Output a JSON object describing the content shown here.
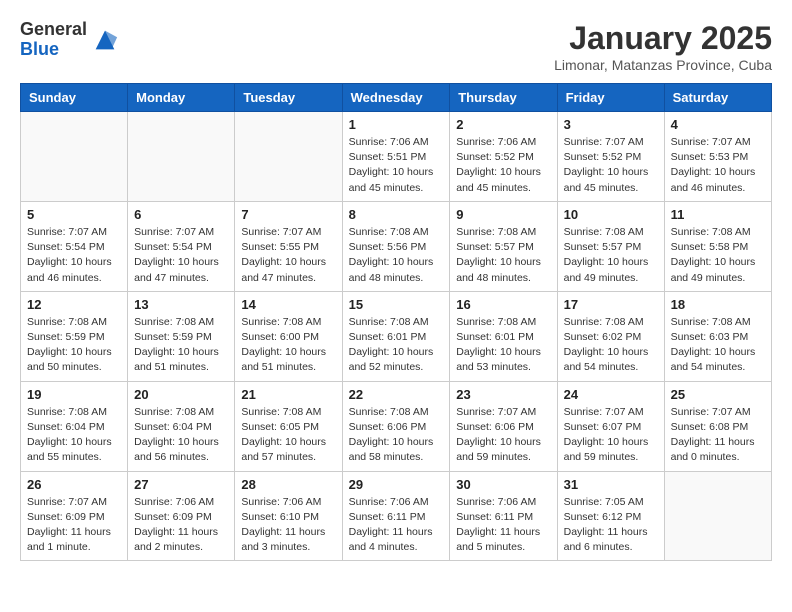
{
  "header": {
    "logo_general": "General",
    "logo_blue": "Blue",
    "month": "January 2025",
    "location": "Limonar, Matanzas Province, Cuba"
  },
  "days_of_week": [
    "Sunday",
    "Monday",
    "Tuesday",
    "Wednesday",
    "Thursday",
    "Friday",
    "Saturday"
  ],
  "weeks": [
    [
      {
        "day": "",
        "info": ""
      },
      {
        "day": "",
        "info": ""
      },
      {
        "day": "",
        "info": ""
      },
      {
        "day": "1",
        "info": "Sunrise: 7:06 AM\nSunset: 5:51 PM\nDaylight: 10 hours\nand 45 minutes."
      },
      {
        "day": "2",
        "info": "Sunrise: 7:06 AM\nSunset: 5:52 PM\nDaylight: 10 hours\nand 45 minutes."
      },
      {
        "day": "3",
        "info": "Sunrise: 7:07 AM\nSunset: 5:52 PM\nDaylight: 10 hours\nand 45 minutes."
      },
      {
        "day": "4",
        "info": "Sunrise: 7:07 AM\nSunset: 5:53 PM\nDaylight: 10 hours\nand 46 minutes."
      }
    ],
    [
      {
        "day": "5",
        "info": "Sunrise: 7:07 AM\nSunset: 5:54 PM\nDaylight: 10 hours\nand 46 minutes."
      },
      {
        "day": "6",
        "info": "Sunrise: 7:07 AM\nSunset: 5:54 PM\nDaylight: 10 hours\nand 47 minutes."
      },
      {
        "day": "7",
        "info": "Sunrise: 7:07 AM\nSunset: 5:55 PM\nDaylight: 10 hours\nand 47 minutes."
      },
      {
        "day": "8",
        "info": "Sunrise: 7:08 AM\nSunset: 5:56 PM\nDaylight: 10 hours\nand 48 minutes."
      },
      {
        "day": "9",
        "info": "Sunrise: 7:08 AM\nSunset: 5:57 PM\nDaylight: 10 hours\nand 48 minutes."
      },
      {
        "day": "10",
        "info": "Sunrise: 7:08 AM\nSunset: 5:57 PM\nDaylight: 10 hours\nand 49 minutes."
      },
      {
        "day": "11",
        "info": "Sunrise: 7:08 AM\nSunset: 5:58 PM\nDaylight: 10 hours\nand 49 minutes."
      }
    ],
    [
      {
        "day": "12",
        "info": "Sunrise: 7:08 AM\nSunset: 5:59 PM\nDaylight: 10 hours\nand 50 minutes."
      },
      {
        "day": "13",
        "info": "Sunrise: 7:08 AM\nSunset: 5:59 PM\nDaylight: 10 hours\nand 51 minutes."
      },
      {
        "day": "14",
        "info": "Sunrise: 7:08 AM\nSunset: 6:00 PM\nDaylight: 10 hours\nand 51 minutes."
      },
      {
        "day": "15",
        "info": "Sunrise: 7:08 AM\nSunset: 6:01 PM\nDaylight: 10 hours\nand 52 minutes."
      },
      {
        "day": "16",
        "info": "Sunrise: 7:08 AM\nSunset: 6:01 PM\nDaylight: 10 hours\nand 53 minutes."
      },
      {
        "day": "17",
        "info": "Sunrise: 7:08 AM\nSunset: 6:02 PM\nDaylight: 10 hours\nand 54 minutes."
      },
      {
        "day": "18",
        "info": "Sunrise: 7:08 AM\nSunset: 6:03 PM\nDaylight: 10 hours\nand 54 minutes."
      }
    ],
    [
      {
        "day": "19",
        "info": "Sunrise: 7:08 AM\nSunset: 6:04 PM\nDaylight: 10 hours\nand 55 minutes."
      },
      {
        "day": "20",
        "info": "Sunrise: 7:08 AM\nSunset: 6:04 PM\nDaylight: 10 hours\nand 56 minutes."
      },
      {
        "day": "21",
        "info": "Sunrise: 7:08 AM\nSunset: 6:05 PM\nDaylight: 10 hours\nand 57 minutes."
      },
      {
        "day": "22",
        "info": "Sunrise: 7:08 AM\nSunset: 6:06 PM\nDaylight: 10 hours\nand 58 minutes."
      },
      {
        "day": "23",
        "info": "Sunrise: 7:07 AM\nSunset: 6:06 PM\nDaylight: 10 hours\nand 59 minutes."
      },
      {
        "day": "24",
        "info": "Sunrise: 7:07 AM\nSunset: 6:07 PM\nDaylight: 10 hours\nand 59 minutes."
      },
      {
        "day": "25",
        "info": "Sunrise: 7:07 AM\nSunset: 6:08 PM\nDaylight: 11 hours\nand 0 minutes."
      }
    ],
    [
      {
        "day": "26",
        "info": "Sunrise: 7:07 AM\nSunset: 6:09 PM\nDaylight: 11 hours\nand 1 minute."
      },
      {
        "day": "27",
        "info": "Sunrise: 7:06 AM\nSunset: 6:09 PM\nDaylight: 11 hours\nand 2 minutes."
      },
      {
        "day": "28",
        "info": "Sunrise: 7:06 AM\nSunset: 6:10 PM\nDaylight: 11 hours\nand 3 minutes."
      },
      {
        "day": "29",
        "info": "Sunrise: 7:06 AM\nSunset: 6:11 PM\nDaylight: 11 hours\nand 4 minutes."
      },
      {
        "day": "30",
        "info": "Sunrise: 7:06 AM\nSunset: 6:11 PM\nDaylight: 11 hours\nand 5 minutes."
      },
      {
        "day": "31",
        "info": "Sunrise: 7:05 AM\nSunset: 6:12 PM\nDaylight: 11 hours\nand 6 minutes."
      },
      {
        "day": "",
        "info": ""
      }
    ]
  ]
}
